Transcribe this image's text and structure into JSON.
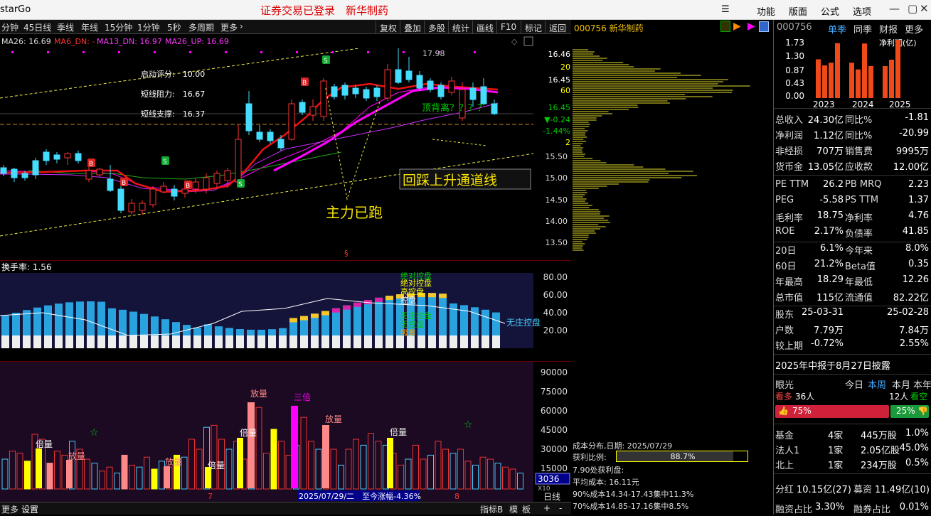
{
  "window": {
    "app": "starGo",
    "center_title": "证券交易已登录　新华制药",
    "menu": [
      "功能",
      "版面",
      "公式",
      "选项"
    ]
  },
  "periods": [
    "分钟",
    "45日线",
    "季线",
    "年线",
    "15分钟",
    "1分钟",
    "5秒",
    "多周期",
    "更多"
  ],
  "tools": [
    "复权",
    "叠加",
    "多股",
    "统计",
    "画线",
    "F10",
    "标记",
    "返回"
  ],
  "stock": {
    "code": "000756",
    "name": "新华制药",
    "header": "000756 新华制药"
  },
  "ma_legend": [
    {
      "text": "MA26: 16.69",
      "color": "#ffffff"
    },
    {
      "text": "MA6_DN: -",
      "color": "#ff2222"
    },
    {
      "text": "MA13_DN: 16.97",
      "color": "#ff33ff"
    },
    {
      "text": "MA26_UP: 16.69",
      "color": "#ff33ff"
    }
  ],
  "indicators": {
    "start_score": "启动评分:　10.00",
    "resist": "短线阻力:　16.67",
    "support": "短线支撑:　16.37"
  },
  "annotations": {
    "top_divergence": "顶背离？？？？",
    "channel": "回踩上升通道线",
    "main_force": "主力已跑",
    "high_mark": "17.98"
  },
  "price_axis": [
    "16.46",
    "20",
    "16.45",
    "60",
    "16.45",
    "▼-0.24",
    "-1.44%",
    "2",
    "15.50",
    "15.00",
    "14.50",
    "14.00",
    "13.50"
  ],
  "turnover": {
    "label": "换手率: 1.56",
    "levels": [
      "80.00",
      "60.00",
      "40.00",
      "20.00"
    ],
    "stack_labels": [
      "绝对控盘",
      "绝对控盘",
      "高控盘",
      "控盘",
      "无庄控盘",
      "无控盘",
      "吸筹",
      "分歧"
    ],
    "no_control": "无庄控盘"
  },
  "volume": {
    "levels": [
      "90000",
      "75000",
      "60000",
      "45000",
      "30000",
      "15000"
    ],
    "current": "3036",
    "unit": "X10",
    "labels": [
      "倍量",
      "放量",
      "放量",
      "倍量",
      "倍量",
      "放量",
      "三倍",
      "放量",
      "倍量"
    ],
    "date_tip": "2025/07/29/二　至今涨幅-4.36%",
    "month_marks": [
      "7",
      "8"
    ],
    "day_line": "日线"
  },
  "cost": {
    "date": "成本分布,日期: 2025/07/29",
    "profit_label": "获利比例:",
    "profit": "88.7%",
    "profit_line": "7.90处获利盘:",
    "avg": "平均成本: 16.11元",
    "c90": "90%成本14.34-17.43集中11.3%",
    "c70": "70%成本14.85-17.16集中8.5%"
  },
  "right_panel": {
    "code": "000756",
    "tabs": [
      "单季",
      "同季",
      "财报",
      "更多"
    ],
    "chart": {
      "y": [
        "1.73",
        "1.30",
        "0.87",
        "0.43",
        "0.00"
      ],
      "years": [
        "2023",
        "2024",
        "2025"
      ],
      "title": "净利润(亿)"
    },
    "fin": [
      [
        "总收入",
        "24.30亿",
        "同比%",
        "-1.81"
      ],
      [
        "净利润",
        "1.12亿",
        "同比%",
        "-20.99"
      ],
      [
        "非经损",
        "707万",
        "销售费",
        "9995万"
      ],
      [
        "货币金",
        "13.05亿",
        "应收款",
        "12.00亿"
      ]
    ],
    "val": [
      [
        "PE TTM",
        "26.2",
        "PB MRQ",
        "2.23"
      ],
      [
        "PEG",
        "-5.58",
        "PS TTM",
        "1.37"
      ],
      [
        "毛利率",
        "18.75",
        "净利率",
        "4.76"
      ],
      [
        "ROE",
        "2.17%",
        "负债率",
        "41.85"
      ]
    ],
    "perf": [
      [
        "20日",
        "6.1%",
        "今年来",
        "8.0%"
      ],
      [
        "60日",
        "21.2%",
        "Beta值",
        "0.35"
      ],
      [
        "年最高",
        "18.29",
        "年最低",
        "12.26"
      ],
      [
        "总市值",
        "115亿",
        "流通值",
        "82.22亿"
      ]
    ],
    "holders": [
      [
        "股东",
        "25-03-31",
        "",
        "25-02-28"
      ],
      [
        "户数",
        "7.79万",
        "",
        "7.84万"
      ],
      [
        "较上期",
        "-0.72%",
        "",
        "2.55%"
      ]
    ],
    "report": "2025年中报于8月27日披露",
    "eye": {
      "label": "眼光",
      "tabs": [
        "今日",
        "本周",
        "本月",
        "本年"
      ],
      "bull": "看多",
      "bull_n": "36人",
      "bear_n": "12人",
      "bear": "看空",
      "bull_pct": "75%",
      "bear_pct": "25%"
    },
    "inst": [
      [
        "基金",
        "4家",
        "445万股",
        "1.0%"
      ],
      [
        "法人1",
        "1家",
        "2.05亿股",
        "45.0%"
      ],
      [
        "北上",
        "1家",
        "234万股",
        "0.5%"
      ]
    ],
    "div": [
      "分红",
      "10.15亿(27)",
      "募资",
      "11.49亿(10)"
    ],
    "margin": [
      "融资占比",
      "3.30%",
      "融券占比",
      "0.01%"
    ]
  },
  "bottom": [
    "更多",
    "设置",
    "指标B",
    "模",
    "板",
    "+",
    "-"
  ]
}
